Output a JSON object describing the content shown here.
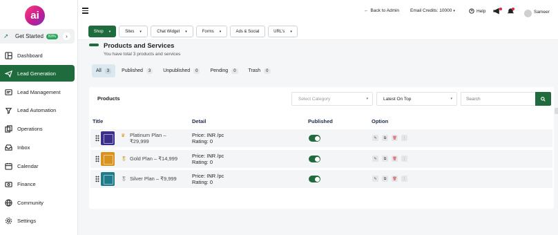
{
  "app": {
    "logo_text": "ai"
  },
  "sidebar": {
    "get_started": {
      "label": "Get Started",
      "badge": "83%",
      "arrow": "›"
    },
    "items": [
      {
        "label": "Dashboard",
        "icon": "dashboard-icon"
      },
      {
        "label": "Lead Generation",
        "icon": "lead-generation-icon",
        "active": true
      },
      {
        "label": "Lead Management",
        "icon": "lead-management-icon"
      },
      {
        "label": "Lead Automation",
        "icon": "lead-automation-icon"
      },
      {
        "label": "Operations",
        "icon": "operations-icon"
      },
      {
        "label": "Inbox",
        "icon": "inbox-icon"
      },
      {
        "label": "Calendar",
        "icon": "calendar-icon"
      },
      {
        "label": "Finance",
        "icon": "finance-icon"
      },
      {
        "label": "Community",
        "icon": "community-icon"
      },
      {
        "label": "Settings",
        "icon": "settings-icon"
      }
    ]
  },
  "topbar": {
    "back_label": "Back to Admin",
    "email_credits": "Email Credits: 10000",
    "help_label": "Help",
    "user_name": "Sameer"
  },
  "filterbar": {
    "buttons": [
      "Shop",
      "Sites",
      "Chat Widget",
      "Forms",
      "Ads & Social",
      "URL's"
    ]
  },
  "page": {
    "title": "Products and Services",
    "subtitle": "You have total 3 products and services"
  },
  "tabs": [
    {
      "label": "All",
      "count": "3"
    },
    {
      "label": "Published",
      "count": "3"
    },
    {
      "label": "Unpublished",
      "count": "0"
    },
    {
      "label": "Pending",
      "count": "0"
    },
    {
      "label": "Trash",
      "count": "0"
    }
  ],
  "products_card": {
    "label": "Products",
    "category_placeholder": "Select Category",
    "sort_value": "Latest On Top",
    "search_placeholder": "Search",
    "columns": [
      "Title",
      "Detail",
      "Published",
      "Option"
    ],
    "rows": [
      {
        "name": "Platinum Plan – ₹29,999",
        "price": "Price: INR /pc",
        "rating": "Rating: 0",
        "thumb_color": "#3b2e8a",
        "published": true
      },
      {
        "name": "Gold Plan – ₹14,999",
        "price": "Price: INR /pc",
        "rating": "Rating: 0",
        "thumb_color": "#d9931c",
        "published": true
      },
      {
        "name": "Silver Plan – ₹9,999",
        "price": "Price: INR /pc",
        "rating": "Rating: 0",
        "thumb_color": "#1f7a8a",
        "published": true
      }
    ]
  },
  "colors": {
    "accent": "#1f6b3d",
    "logo_gradient_start": "#ff3b7a",
    "logo_gradient_end": "#7b2fbf"
  }
}
